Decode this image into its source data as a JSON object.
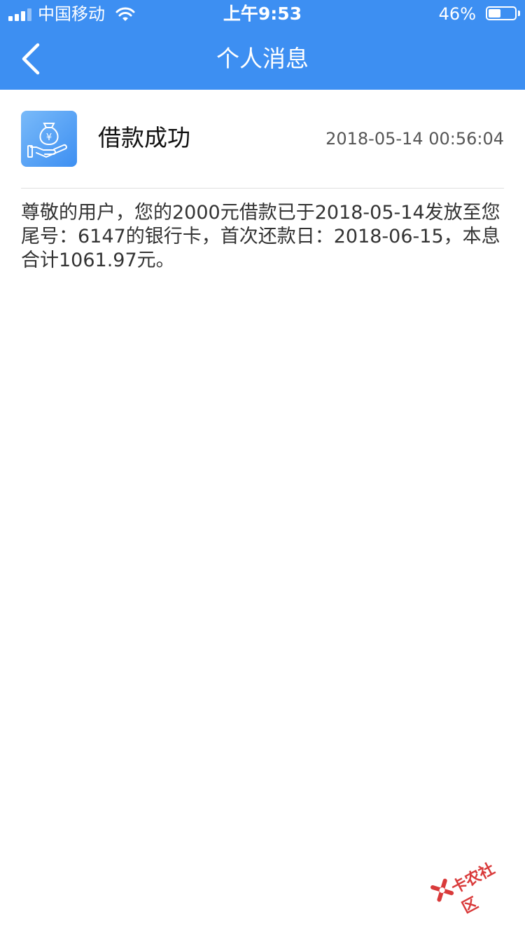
{
  "status_bar": {
    "carrier": "中国移动",
    "time": "上午9:53",
    "battery_percent": "46%",
    "battery_level": 0.46
  },
  "nav": {
    "title": "个人消息"
  },
  "message": {
    "title": "借款成功",
    "time": "2018-05-14 00:56:04",
    "body": "尊敬的用户，您的2000元借款已于2018-05-14发放至您尾号：6147的银行卡，首次还款日：2018-06-15，本息合计1061.97元。"
  },
  "watermark": {
    "text": "卡农社区"
  },
  "colors": {
    "accent": "#3d8ff2",
    "icon_gradient_light": "#79baf9",
    "watermark": "#d93a3a"
  }
}
